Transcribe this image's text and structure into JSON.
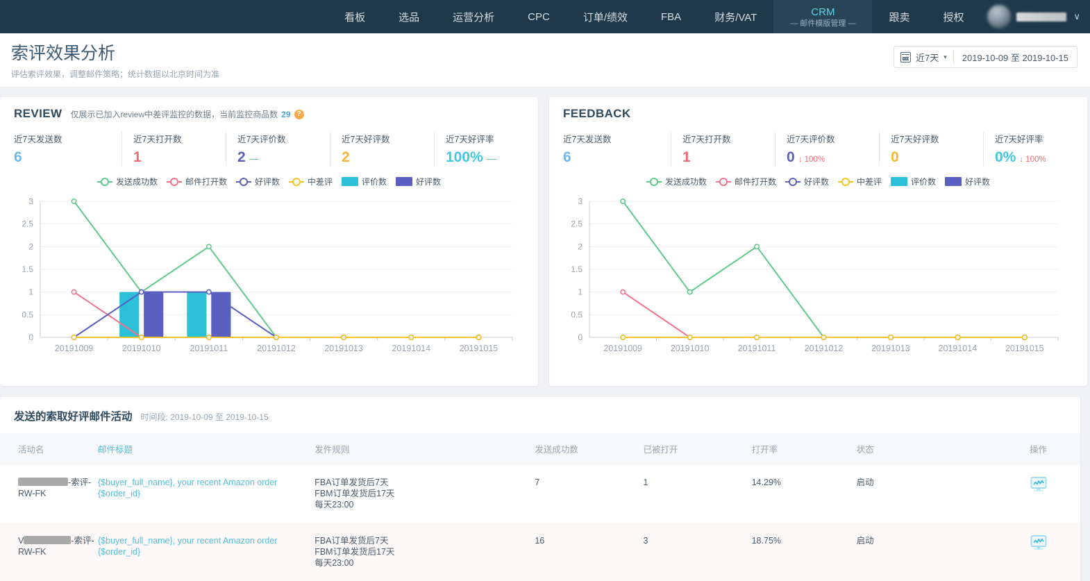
{
  "nav": {
    "items": [
      {
        "label": "看板"
      },
      {
        "label": "选品"
      },
      {
        "label": "运营分析"
      },
      {
        "label": "CPC"
      },
      {
        "label": "订单/绩效"
      },
      {
        "label": "FBA"
      },
      {
        "label": "财务/VAT"
      },
      {
        "label": "CRM",
        "sub": "— 邮件模版管理 —",
        "active": true
      },
      {
        "label": "跟卖"
      },
      {
        "label": "授权"
      }
    ],
    "user": {
      "name_redacted": true,
      "caret": "∨"
    }
  },
  "header": {
    "title": "索评效果分析",
    "subtitle": "评估索评效果，调整邮件策略；统计数据以北京时间为准",
    "date_picker": {
      "calendar_icon": "calendar-icon",
      "preset_label": "近7天",
      "caret": "▾",
      "range": "2019-10-09 至 2019-10-15"
    }
  },
  "review_panel": {
    "title": "REVIEW",
    "note_prefix": "仅展示已加入review中差评监控的数据，当前监控商品数",
    "note_count": "29",
    "help_icon": "?",
    "kpis": [
      {
        "label": "近7天发送数",
        "value": "6",
        "color": "#6fb8e8",
        "trend": "",
        "trend_type": "none"
      },
      {
        "label": "近7天打开数",
        "value": "1",
        "color": "#ef6b72",
        "trend": "",
        "trend_type": "none"
      },
      {
        "label": "近7天评价数",
        "value": "2",
        "color": "#5b5fc0",
        "trend": "—",
        "trend_type": "flat"
      },
      {
        "label": "近7天好评数",
        "value": "2",
        "color": "#f7b733",
        "trend": "",
        "trend_type": "none"
      },
      {
        "label": "近7天好评率",
        "value": "100%",
        "color": "#3fc8e0",
        "trend": "—",
        "trend_type": "flat"
      }
    ]
  },
  "feedback_panel": {
    "title": "FEEDBACK",
    "kpis": [
      {
        "label": "近7天发送数",
        "value": "6",
        "color": "#6fb8e8",
        "trend": "",
        "trend_type": "none"
      },
      {
        "label": "近7天打开数",
        "value": "1",
        "color": "#ef6b72",
        "trend": "",
        "trend_type": "none"
      },
      {
        "label": "近7天评价数",
        "value": "0",
        "color": "#5b5fc0",
        "trend": "↓ 100%",
        "trend_type": "down"
      },
      {
        "label": "近7天好评数",
        "value": "0",
        "color": "#f7b733",
        "trend": "",
        "trend_type": "none"
      },
      {
        "label": "近7天好评率",
        "value": "0%",
        "color": "#3fc8e0",
        "trend": "↓ 100%",
        "trend_type": "down"
      }
    ]
  },
  "legend": [
    {
      "label": "发送成功数",
      "color": "#5ec98a",
      "shape": "line"
    },
    {
      "label": "邮件打开数",
      "color": "#f2738c",
      "shape": "line"
    },
    {
      "label": "好评数",
      "color": "#5b5fc0",
      "shape": "line"
    },
    {
      "label": "中差评",
      "color": "#f7c427",
      "shape": "line"
    },
    {
      "label": "评价数",
      "color": "#2bc0d8",
      "shape": "bar"
    },
    {
      "label": "好评数",
      "color": "#5b5fc0",
      "shape": "bar"
    }
  ],
  "chart_data": [
    {
      "id": "review",
      "type": "line",
      "title": "REVIEW",
      "xlabel": "",
      "ylabel": "",
      "ylim": [
        0,
        3
      ],
      "yticks": [
        0,
        0.5,
        1,
        1.5,
        2,
        2.5,
        3
      ],
      "ytick_labels": [
        "0",
        "0.5",
        "1",
        "1.5",
        "2",
        "2.5",
        "3"
      ],
      "grid": true,
      "legend_position": "top-center",
      "categories": [
        "20191009",
        "20191010",
        "20191011",
        "20191012",
        "20191013",
        "20191014",
        "20191015"
      ],
      "series": [
        {
          "name": "发送成功数",
          "type": "line",
          "color": "#5ec98a",
          "values": [
            3,
            1,
            2,
            0,
            0,
            0,
            0
          ]
        },
        {
          "name": "邮件打开数",
          "type": "line",
          "color": "#f2738c",
          "values": [
            1,
            0,
            0,
            0,
            0,
            0,
            0
          ]
        },
        {
          "name": "好评数",
          "type": "line",
          "color": "#5b5fc0",
          "values": [
            0,
            1,
            1,
            0,
            0,
            0,
            0
          ]
        },
        {
          "name": "中差评",
          "type": "line",
          "color": "#f7c427",
          "values": [
            0,
            0,
            0,
            0,
            0,
            0,
            0
          ]
        },
        {
          "name": "评价数",
          "type": "bar",
          "color": "#2bc0d8",
          "values": [
            0,
            1,
            1,
            0,
            0,
            0,
            0
          ]
        },
        {
          "name": "好评数",
          "type": "bar",
          "color": "#5b5fc0",
          "values": [
            0,
            1,
            1,
            0,
            0,
            0,
            0
          ]
        }
      ]
    },
    {
      "id": "feedback",
      "type": "line",
      "title": "FEEDBACK",
      "xlabel": "",
      "ylabel": "",
      "ylim": [
        0,
        3
      ],
      "yticks": [
        0,
        0.5,
        1,
        1.5,
        2,
        2.5,
        3
      ],
      "ytick_labels": [
        "0",
        "0.5",
        "1",
        "1.5",
        "2",
        "2.5",
        "3"
      ],
      "grid": true,
      "legend_position": "top-center",
      "categories": [
        "20191009",
        "20191010",
        "20191011",
        "20191012",
        "20191013",
        "20191014",
        "20191015"
      ],
      "series": [
        {
          "name": "发送成功数",
          "type": "line",
          "color": "#5ec98a",
          "values": [
            3,
            1,
            2,
            0,
            0,
            0,
            0
          ]
        },
        {
          "name": "邮件打开数",
          "type": "line",
          "color": "#f2738c",
          "values": [
            1,
            0,
            0,
            0,
            0,
            0,
            0
          ]
        },
        {
          "name": "好评数",
          "type": "line",
          "color": "#5b5fc0",
          "values": [
            0,
            0,
            0,
            0,
            0,
            0,
            0
          ]
        },
        {
          "name": "中差评",
          "type": "line",
          "color": "#f7c427",
          "values": [
            0,
            0,
            0,
            0,
            0,
            0,
            0
          ]
        },
        {
          "name": "评价数",
          "type": "bar",
          "color": "#2bc0d8",
          "values": [
            0,
            0,
            0,
            0,
            0,
            0,
            0
          ]
        },
        {
          "name": "好评数",
          "type": "bar",
          "color": "#5b5fc0",
          "values": [
            0,
            0,
            0,
            0,
            0,
            0,
            0
          ]
        }
      ]
    }
  ],
  "table": {
    "title": "发送的索取好评邮件活动",
    "period_label": "时间段:",
    "period": "2019-10-09 至 2019-10-15",
    "columns": [
      "活动名",
      "邮件标题",
      "发件规则",
      "发送成功数",
      "已被打开",
      "打开率",
      "状态",
      "操作"
    ],
    "rows": [
      {
        "name_prefix": "",
        "name_suffix": "-索评-RW-FK",
        "subject": "{$buyer_full_name}, your recent Amazon order {$order_id}",
        "rule": "FBA订单发货后7天\nFBM订单发货后17天\n每天23:00",
        "sent": "7",
        "opened": "1",
        "open_rate": "14.29%",
        "status": "启动",
        "action_icon": "monitor-chart-icon"
      },
      {
        "name_prefix": "V",
        "name_suffix": "-索评-RW-FK",
        "subject": "{$buyer_full_name}, your recent Amazon order {$order_id}",
        "rule": "FBA订单发货后7天\nFBM订单发货后17天\n每天23:00",
        "sent": "16",
        "opened": "3",
        "open_rate": "18.75%",
        "status": "启动",
        "action_icon": "monitor-chart-icon"
      }
    ]
  }
}
